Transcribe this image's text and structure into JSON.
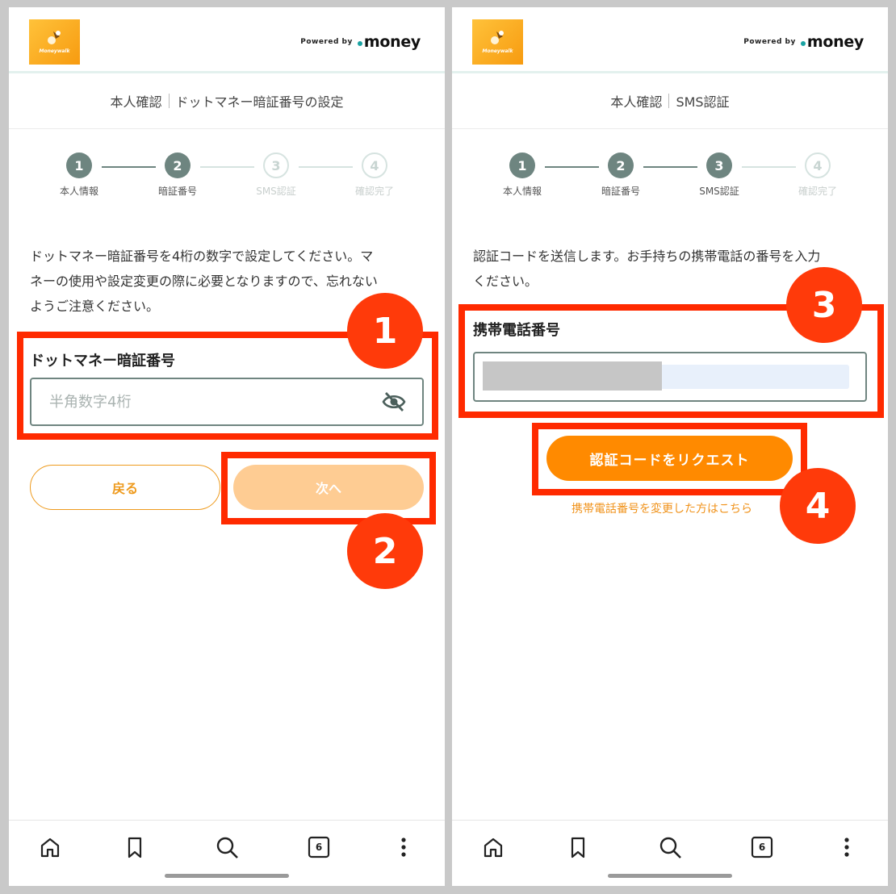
{
  "brand": {
    "logo_text": "Moneywalk",
    "powered_by": "Powered by",
    "powered_brand": "money"
  },
  "colors": {
    "accent_orange": "#ff8a00",
    "highlight_red": "#ff2a00",
    "step_active": "#6e8580"
  },
  "left": {
    "title_part1": "本人確認",
    "title_part2": "ドットマネー暗証番号の設定",
    "steps": [
      {
        "num": "1",
        "label": "本人情報",
        "active": true
      },
      {
        "num": "2",
        "label": "暗証番号",
        "active": true
      },
      {
        "num": "3",
        "label": "SMS認証",
        "active": false
      },
      {
        "num": "4",
        "label": "確認完了",
        "active": false
      }
    ],
    "desc_lines": [
      "ドットマネー暗証番号を4桁の数字で設定してください。マ",
      "ネーの使用や設定変更の際に必要となりますので、忘れない",
      "ようご注意ください。"
    ],
    "field_label": "ドットマネー暗証番号",
    "pin_placeholder": "半角数字4桁",
    "back_label": "戻る",
    "next_label": "次へ",
    "badges": [
      "1",
      "2"
    ]
  },
  "right": {
    "title_part1": "本人確認",
    "title_part2": "SMS認証",
    "steps": [
      {
        "num": "1",
        "label": "本人情報",
        "active": true
      },
      {
        "num": "2",
        "label": "暗証番号",
        "active": true
      },
      {
        "num": "3",
        "label": "SMS認証",
        "active": true
      },
      {
        "num": "4",
        "label": "確認完了",
        "active": false
      }
    ],
    "desc_lines": [
      "認証コードを送信します。お手持ちの携帯電話の番号を入力",
      "ください。"
    ],
    "field_label": "携帯電話番号",
    "request_label": "認証コードをリクエスト",
    "change_link": "携帯電話番号を変更した方はこちら",
    "badges": [
      "3",
      "4"
    ]
  },
  "nav": {
    "icons": [
      "home-icon",
      "bookmark-icon",
      "search-icon",
      "tabs-icon",
      "more-icon"
    ],
    "tab_count": "6"
  }
}
